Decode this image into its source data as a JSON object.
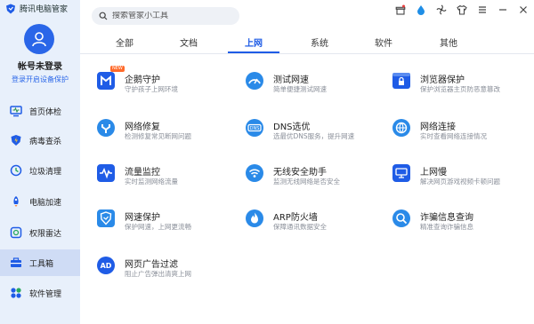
{
  "app": {
    "title": "腾讯电脑管家"
  },
  "account": {
    "name": "帐号未登录",
    "login_prompt": "登录开启设备保护"
  },
  "sidebar": {
    "items": [
      {
        "label": "首页体检",
        "icon": "monitor-icon"
      },
      {
        "label": "病毒查杀",
        "icon": "shield-lightning-icon"
      },
      {
        "label": "垃圾清理",
        "icon": "recycle-icon"
      },
      {
        "label": "电脑加速",
        "icon": "rocket-icon"
      },
      {
        "label": "权限雷达",
        "icon": "radar-icon"
      },
      {
        "label": "工具箱",
        "icon": "toolbox-icon",
        "active": true
      },
      {
        "label": "软件管理",
        "icon": "apps-icon"
      }
    ]
  },
  "search": {
    "placeholder": "搜索管家小工具"
  },
  "tabs": [
    {
      "label": "全部"
    },
    {
      "label": "文档"
    },
    {
      "label": "上网",
      "active": true
    },
    {
      "label": "系统"
    },
    {
      "label": "软件"
    },
    {
      "label": "其他"
    }
  ],
  "tools": [
    {
      "name": "企鹅守护",
      "desc": "守护孩子上网环境",
      "icon": "penguin-guard-icon",
      "badge": "NEW"
    },
    {
      "name": "测试网速",
      "desc": "简单便捷测试网速",
      "icon": "speedometer-icon"
    },
    {
      "name": "浏览器保护",
      "desc": "保护浏览器主页防恶意篡改",
      "icon": "browser-lock-icon"
    },
    {
      "name": "网络修复",
      "desc": "检测修复常见断网问题",
      "icon": "wrench-icon"
    },
    {
      "name": "DNS选优",
      "desc": "选最优DNS服务，提升网速",
      "icon": "dns-icon"
    },
    {
      "name": "网络连接",
      "desc": "实时查看网络连接情况",
      "icon": "globe-icon"
    },
    {
      "name": "流量监控",
      "desc": "实时监测网络流量",
      "icon": "traffic-wave-icon"
    },
    {
      "name": "无线安全助手",
      "desc": "监测无线网络是否安全",
      "icon": "wifi-icon"
    },
    {
      "name": "上网慢",
      "desc": "解决网页游戏视频卡顿问题",
      "icon": "network-slow-icon"
    },
    {
      "name": "网速保护",
      "desc": "保护网速，上网更流畅",
      "icon": "speed-shield-icon"
    },
    {
      "name": "ARP防火墙",
      "desc": "保障通讯数据安全",
      "icon": "firewall-icon"
    },
    {
      "name": "诈骗信息查询",
      "desc": "精准查询诈骗信息",
      "icon": "fraud-search-icon"
    },
    {
      "name": "网页广告过滤",
      "desc": "阻止广告弹出清爽上网",
      "icon": "ad-block-icon"
    }
  ],
  "colors": {
    "accent": "#1f5ce6",
    "sidebar_bg": "#e8f0fb",
    "badge": "#ff6a2a"
  }
}
